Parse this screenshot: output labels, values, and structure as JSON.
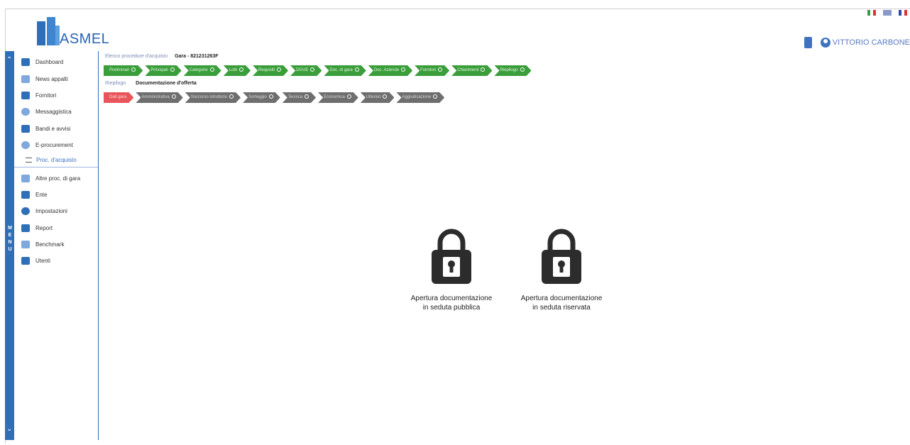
{
  "brand": {
    "name": "ASMEL"
  },
  "languages": [
    "it",
    "en",
    "fr"
  ],
  "topbar": {
    "user_name": "VITTORIO CARBONE"
  },
  "menu_strip": {
    "letters": [
      "M",
      "E",
      "N",
      "U"
    ]
  },
  "sidebar": {
    "items": [
      {
        "label": "Dashboard"
      },
      {
        "label": "News appalti"
      },
      {
        "label": "Fornitori"
      },
      {
        "label": "Messaggistica"
      },
      {
        "label": "Bandi e avvisi"
      },
      {
        "label": "E-procurement"
      }
    ],
    "sub_item": {
      "label": "Proc. d'acquisto"
    },
    "items_after": [
      {
        "label": "Altre proc. di gara"
      },
      {
        "label": "Ente"
      },
      {
        "label": "Impostazioni"
      },
      {
        "label": "Report"
      },
      {
        "label": "Benchmark"
      },
      {
        "label": "Utenti"
      }
    ]
  },
  "breadcrumb": {
    "parent": "Elenco procedure d'acquisto",
    "current": "Gara - 821231263F"
  },
  "green_steps": [
    "Preliminari",
    "Principali",
    "Categorie",
    "Lotti",
    "Requisiti",
    "DGUE",
    "Doc. di gara",
    "Doc. Aziende",
    "Fornitori",
    "Chiarimenti",
    "Riepilogo"
  ],
  "sub_breadcrumb": {
    "parent": "Riepilogo",
    "current": "Documentazione d'offerta"
  },
  "gray_steps": [
    "Dati gara",
    "Amministrativa",
    "Soccorso istruttorio",
    "Sorteggio",
    "Tecnica",
    "Economica",
    "Ulteriori",
    "Aggiudicazione"
  ],
  "locks": {
    "public": "Apertura documentazione in seduta pubblica",
    "private": "Apertura documentazione in seduta riservata"
  }
}
